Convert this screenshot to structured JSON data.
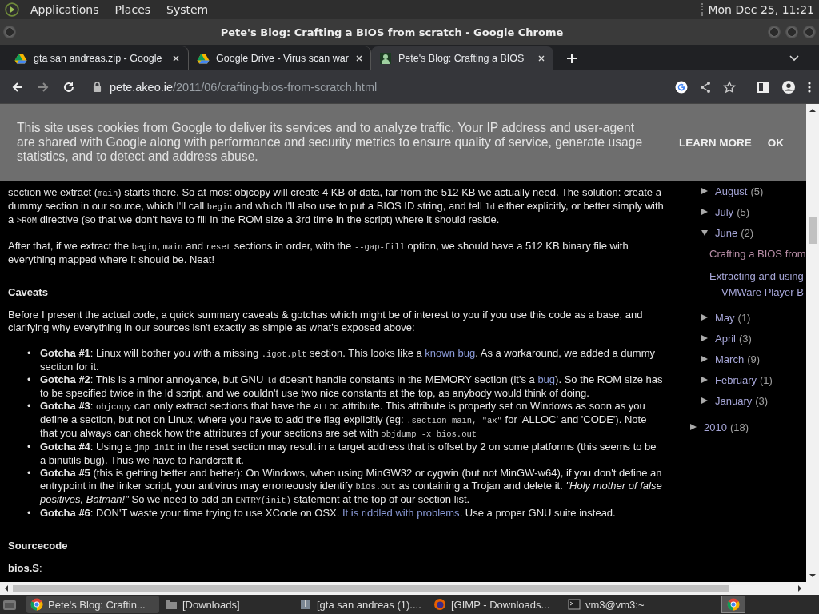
{
  "top_panel": {
    "menus": [
      "Applications",
      "Places",
      "System"
    ],
    "clock": "Mon Dec 25, 11:21"
  },
  "window": {
    "title": "Pete's Blog: Crafting a BIOS from scratch - Google Chrome"
  },
  "tabs": [
    {
      "label": "gta san andreas.zip - Google",
      "kind": "drive",
      "selected": false
    },
    {
      "label": "Google Drive - Virus scan war",
      "kind": "drive",
      "selected": false
    },
    {
      "label": "Pete's Blog: Crafting a BIOS",
      "kind": "blog",
      "selected": true
    }
  ],
  "address_bar": {
    "host": "pete.akeo.ie",
    "path": "/2011/06/crafting-bios-from-scratch.html"
  },
  "cookie_banner": {
    "text": "This site uses cookies from Google to deliver its services and to analyze traffic. Your IP address and user-agent are shared with Google along with performance and security metrics to ensure quality of service, generate usage statistics, and to detect and address abuse.",
    "buttons": [
      "LEARN MORE",
      "OK"
    ]
  },
  "article": [
    {
      "kind": "paragraph",
      "segments": [
        {
          "kind": "text",
          "text": "section we extract ("
        },
        {
          "kind": "code",
          "text": "main"
        },
        {
          "kind": "text",
          "text": ") starts there. So at most objcopy will create 4 KB of data, far from the 512 KB we actually need. The solution: create a dummy section in our source, which I'll call "
        },
        {
          "kind": "code",
          "text": "begin"
        },
        {
          "kind": "text",
          "text": " and which I'll also use to put a BIOS ID string, and tell "
        },
        {
          "kind": "code",
          "text": "ld"
        },
        {
          "kind": "text",
          "text": " either explicitly, or better simply with a "
        },
        {
          "kind": "code",
          "text": ">ROM"
        },
        {
          "kind": "text",
          "text": " directive (so that we don't have to fill in the ROM size a 3rd time in the script) where it should reside."
        }
      ]
    },
    {
      "kind": "paragraph",
      "segments": [
        {
          "kind": "text",
          "text": "After that, if we extract the "
        },
        {
          "kind": "code",
          "text": "begin"
        },
        {
          "kind": "text",
          "text": ", "
        },
        {
          "kind": "code",
          "text": "main"
        },
        {
          "kind": "text",
          "text": " and "
        },
        {
          "kind": "code",
          "text": "reset"
        },
        {
          "kind": "text",
          "text": " sections in order, with the "
        },
        {
          "kind": "code",
          "text": "--gap-fill"
        },
        {
          "kind": "text",
          "text": " option, we should have a 512 KB binary file with everything mapped where it should be. Neat!"
        }
      ]
    },
    {
      "kind": "heading",
      "text": "Caveats"
    },
    {
      "kind": "paragraph",
      "segments": [
        {
          "kind": "text",
          "text": "Before I present the actual code, a quick summary caveats & gotchas which might be of interest to you if you use this code as a base, and clarifying why everything in our sources isn't exactly as simple as what's exposed above:"
        }
      ]
    },
    {
      "kind": "list",
      "marker": "•",
      "items": [
        [
          {
            "kind": "bold",
            "text": "Gotcha #1"
          },
          {
            "kind": "text",
            "text": ": Linux will bother you with a missing "
          },
          {
            "kind": "code",
            "text": ".igot.plt"
          },
          {
            "kind": "text",
            "text": " section. This looks like a "
          },
          {
            "kind": "link",
            "text": "known bug"
          },
          {
            "kind": "text",
            "text": ". As a workaround, we added a dummy section for it."
          }
        ],
        [
          {
            "kind": "bold",
            "text": "Gotcha #2"
          },
          {
            "kind": "text",
            "text": ": This is a minor annoyance, but GNU "
          },
          {
            "kind": "code",
            "text": "ld"
          },
          {
            "kind": "text",
            "text": " doesn't handle constants in the MEMORY section (it's a "
          },
          {
            "kind": "link",
            "text": "bug"
          },
          {
            "kind": "text",
            "text": "). So the ROM size has to be specified twice in the ld script, and we couldn't use two nice constants at the top, as anybody would think of doing."
          }
        ],
        [
          {
            "kind": "bold",
            "text": "Gotcha #3"
          },
          {
            "kind": "text",
            "text": ": "
          },
          {
            "kind": "code",
            "text": "objcopy"
          },
          {
            "kind": "text",
            "text": " can only extract sections that have the "
          },
          {
            "kind": "code",
            "text": "ALLOC"
          },
          {
            "kind": "text",
            "text": " attribute. This attribute is properly set on Windows as soon as you define a section, but not on Linux, where you have to add the flag explicitly (eg: "
          },
          {
            "kind": "code",
            "text": ".section main, \"ax\""
          },
          {
            "kind": "text",
            "text": " for 'ALLOC' and 'CODE'). Note that you always can check how the attributes of your sections are set with "
          },
          {
            "kind": "code",
            "text": "objdump -x bios.out"
          }
        ],
        [
          {
            "kind": "bold",
            "text": "Gotcha #4"
          },
          {
            "kind": "text",
            "text": ": Using a "
          },
          {
            "kind": "code",
            "text": "jmp init"
          },
          {
            "kind": "text",
            "text": " in the reset section may result in a target address that is offset by 2 on some platforms (this seems to be a binutils bug). Thus we have to handcraft it."
          }
        ],
        [
          {
            "kind": "bold",
            "text": "Gotcha #5"
          },
          {
            "kind": "text",
            "text": " (this is getting better and better): On Windows, when using MinGW32 or cygwin (but not MinGW-w64), if you don't define an entrypoint in the linker script, your antivirus may erroneously identify "
          },
          {
            "kind": "code",
            "text": "bios.out"
          },
          {
            "kind": "text",
            "text": " as containing a Trojan and delete it. "
          },
          {
            "kind": "italic",
            "text": "\"Holy mother of false positives, Batman!\""
          },
          {
            "kind": "text",
            "text": " So we need to add an "
          },
          {
            "kind": "code",
            "text": "ENTRY(init)"
          },
          {
            "kind": "text",
            "text": " statement at the top of our section list."
          }
        ],
        [
          {
            "kind": "bold",
            "text": "Gotcha #6"
          },
          {
            "kind": "text",
            "text": ": DON'T waste your time trying to use XCode on OSX. "
          },
          {
            "kind": "link",
            "text": "It is riddled with problems"
          },
          {
            "kind": "text",
            "text": ". Use a proper GNU suite instead."
          }
        ]
      ]
    },
    {
      "kind": "heading",
      "text": "Sourcecode"
    },
    {
      "kind": "paragraph",
      "segments": [
        {
          "kind": "bold",
          "text": "bios.S"
        },
        {
          "kind": "text",
          "text": ":"
        }
      ]
    }
  ],
  "archive": [
    {
      "children": [
        {
          "label": "August",
          "count": "(5)",
          "expanded": false
        },
        {
          "label": "July",
          "count": "(5)",
          "expanded": false
        },
        {
          "label": "June",
          "count": "(2)",
          "expanded": true,
          "posts": [
            {
              "title": "Crafting a BIOS from",
              "selected": true
            },
            {
              "title": "Extracting and using VMWare Player B",
              "selected": false
            }
          ]
        },
        {
          "label": "May",
          "count": "(1)",
          "expanded": false
        },
        {
          "label": "April",
          "count": "(3)",
          "expanded": false
        },
        {
          "label": "March",
          "count": "(9)",
          "expanded": false
        },
        {
          "label": "February",
          "count": "(1)",
          "expanded": false
        },
        {
          "label": "January",
          "count": "(3)",
          "expanded": false
        }
      ]
    },
    {
      "label": "2010",
      "count": "(18)",
      "expanded": false
    }
  ],
  "taskbar": [
    {
      "label": "Pete's Blog: Craftin...",
      "kind": "chrome",
      "selected": true
    },
    {
      "label": "[Downloads]",
      "kind": "folder",
      "selected": false
    },
    {
      "label": "[gta san andreas (1)....",
      "kind": "archive",
      "selected": false
    },
    {
      "label": "[GIMP - Downloads...",
      "kind": "firefox",
      "selected": false
    },
    {
      "label": "vm3@vm3:~",
      "kind": "terminal",
      "selected": false
    }
  ]
}
